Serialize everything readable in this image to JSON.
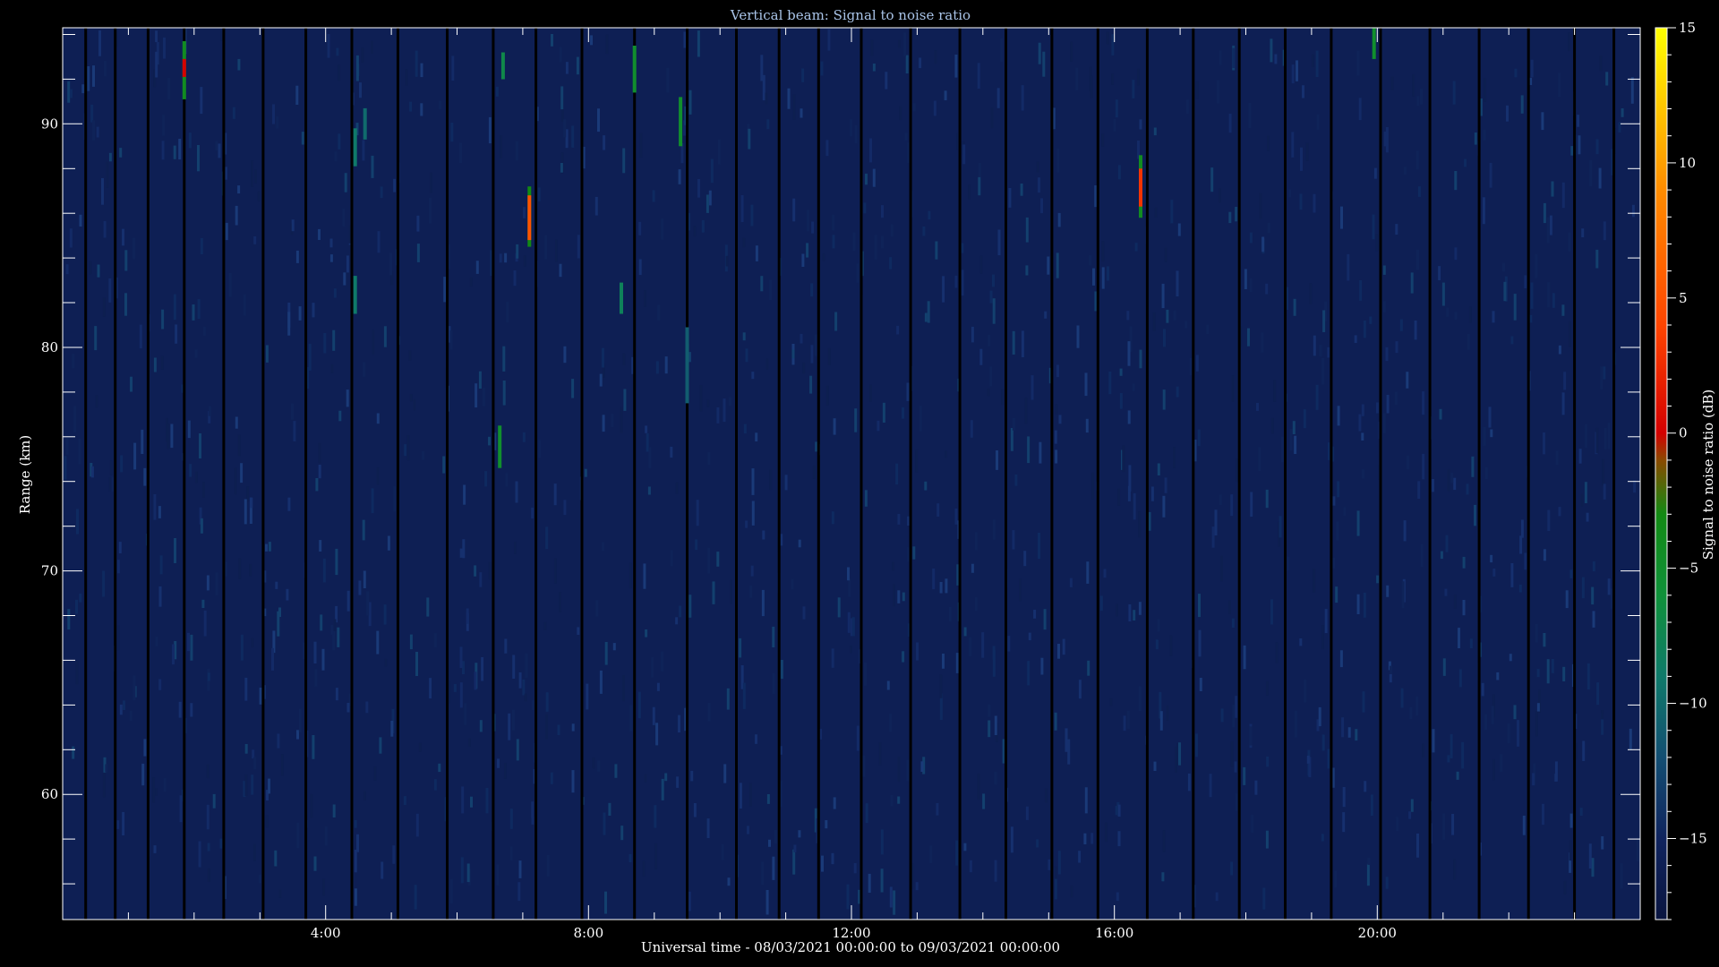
{
  "colors": {
    "background": "#000000",
    "axis": "#ffffff",
    "plot_background": "#0b1a45",
    "title_text": "#a9c4e8"
  },
  "chart_data": {
    "type": "heatmap",
    "title": "Vertical beam: Signal to noise ratio",
    "xlabel": "Universal time - 08/03/2021 00:00:00 to 09/03/2021 00:00:00",
    "ylabel": "Range (km)",
    "xlim": [
      0,
      24
    ],
    "ylim": [
      54.4,
      94.3
    ],
    "xticks": [
      {
        "value": 4,
        "label": "4:00"
      },
      {
        "value": 8,
        "label": "8:00"
      },
      {
        "value": 12,
        "label": "12:00"
      },
      {
        "value": 16,
        "label": "16:00"
      },
      {
        "value": 20,
        "label": "20:00"
      }
    ],
    "yticks": [
      {
        "value": 60,
        "label": "60"
      },
      {
        "value": 70,
        "label": "70"
      },
      {
        "value": 80,
        "label": "80"
      },
      {
        "value": 90,
        "label": "90"
      }
    ],
    "colorbar": {
      "label": "Signal to noise ratio (dB)",
      "min": -18,
      "max": 15,
      "ticks": [
        {
          "value": -15,
          "label": "−15"
        },
        {
          "value": -10,
          "label": "−10"
        },
        {
          "value": -5,
          "label": "−5"
        },
        {
          "value": 0,
          "label": "0"
        },
        {
          "value": 5,
          "label": "5"
        },
        {
          "value": 10,
          "label": "10"
        },
        {
          "value": 15,
          "label": "15"
        }
      ],
      "colormap": [
        {
          "value": -18,
          "color": "#0a1540"
        },
        {
          "value": -15,
          "color": "#10245e"
        },
        {
          "value": -12,
          "color": "#134e72"
        },
        {
          "value": -9,
          "color": "#0f7a6a"
        },
        {
          "value": -6,
          "color": "#10913a"
        },
        {
          "value": -3,
          "color": "#138a14"
        },
        {
          "value": -1,
          "color": "#8a4a00"
        },
        {
          "value": 0,
          "color": "#d40000"
        },
        {
          "value": 4,
          "color": "#ff4500"
        },
        {
          "value": 9,
          "color": "#ff8c00"
        },
        {
          "value": 15,
          "color": "#ffff00"
        }
      ]
    },
    "background_snr": -16,
    "gap_times": [
      0.35,
      0.8,
      1.3,
      1.85,
      2.45,
      3.05,
      3.7,
      4.4,
      5.1,
      5.85,
      6.55,
      7.2,
      7.9,
      8.7,
      9.5,
      10.25,
      10.9,
      11.5,
      12.15,
      12.9,
      13.65,
      14.35,
      15.05,
      15.75,
      16.5,
      17.2,
      17.9,
      18.6,
      19.3,
      20.05,
      20.8,
      21.55,
      22.3,
      23.0,
      23.6
    ],
    "echoes": [
      {
        "t": 1.85,
        "r0": 91.1,
        "r1": 93.7,
        "snr": -4
      },
      {
        "t": 1.85,
        "r0": 92.1,
        "r1": 92.9,
        "snr": 0
      },
      {
        "t": 4.45,
        "r0": 88.1,
        "r1": 89.8,
        "snr": -9
      },
      {
        "t": 4.45,
        "r0": 81.5,
        "r1": 83.2,
        "snr": -9
      },
      {
        "t": 4.6,
        "r0": 89.3,
        "r1": 90.7,
        "snr": -10
      },
      {
        "t": 6.65,
        "r0": 74.6,
        "r1": 76.5,
        "snr": -5
      },
      {
        "t": 6.7,
        "r0": 92.0,
        "r1": 93.2,
        "snr": -7
      },
      {
        "t": 7.1,
        "r0": 84.5,
        "r1": 87.2,
        "snr": -3
      },
      {
        "t": 7.1,
        "r0": 84.8,
        "r1": 86.8,
        "snr": 5
      },
      {
        "t": 8.5,
        "r0": 81.5,
        "r1": 82.9,
        "snr": -8
      },
      {
        "t": 8.7,
        "r0": 91.4,
        "r1": 93.5,
        "snr": -5
      },
      {
        "t": 9.4,
        "r0": 89.0,
        "r1": 91.2,
        "snr": -5
      },
      {
        "t": 9.5,
        "r0": 77.5,
        "r1": 80.9,
        "snr": -11
      },
      {
        "t": 16.4,
        "r0": 85.8,
        "r1": 88.6,
        "snr": -4
      },
      {
        "t": 16.4,
        "r0": 86.3,
        "r1": 88.0,
        "snr": 3
      },
      {
        "t": 19.95,
        "r0": 92.9,
        "r1": 94.3,
        "snr": -5
      }
    ]
  }
}
